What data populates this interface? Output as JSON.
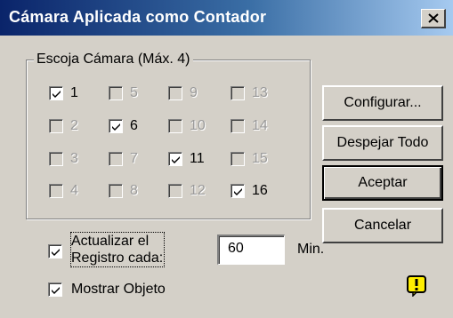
{
  "window": {
    "title": "Cámara Aplicada como Contador"
  },
  "group": {
    "title": "Escoja Cámara (Máx. 4)"
  },
  "cameras": [
    {
      "label": "1",
      "checked": true,
      "enabled": true
    },
    {
      "label": "2",
      "checked": false,
      "enabled": false
    },
    {
      "label": "3",
      "checked": false,
      "enabled": false
    },
    {
      "label": "4",
      "checked": false,
      "enabled": false
    },
    {
      "label": "5",
      "checked": false,
      "enabled": false
    },
    {
      "label": "6",
      "checked": true,
      "enabled": true
    },
    {
      "label": "7",
      "checked": false,
      "enabled": false
    },
    {
      "label": "8",
      "checked": false,
      "enabled": false
    },
    {
      "label": "9",
      "checked": false,
      "enabled": false
    },
    {
      "label": "10",
      "checked": false,
      "enabled": false
    },
    {
      "label": "11",
      "checked": true,
      "enabled": true
    },
    {
      "label": "12",
      "checked": false,
      "enabled": false
    },
    {
      "label": "13",
      "checked": false,
      "enabled": false
    },
    {
      "label": "14",
      "checked": false,
      "enabled": false
    },
    {
      "label": "15",
      "checked": false,
      "enabled": false
    },
    {
      "label": "16",
      "checked": true,
      "enabled": true
    }
  ],
  "buttons": {
    "configure": "Configurar...",
    "clear_all": "Despejar Todo",
    "accept": "Aceptar",
    "cancel": "Cancelar"
  },
  "update_log": {
    "label_line1": "Actualizar el",
    "label_line2": "Registro cada:",
    "checked": true,
    "value": "60",
    "unit": "Min."
  },
  "show_object": {
    "label": "Mostrar Objeto",
    "checked": true
  },
  "icons": {
    "close": "close-icon",
    "warning": "warning-icon"
  }
}
